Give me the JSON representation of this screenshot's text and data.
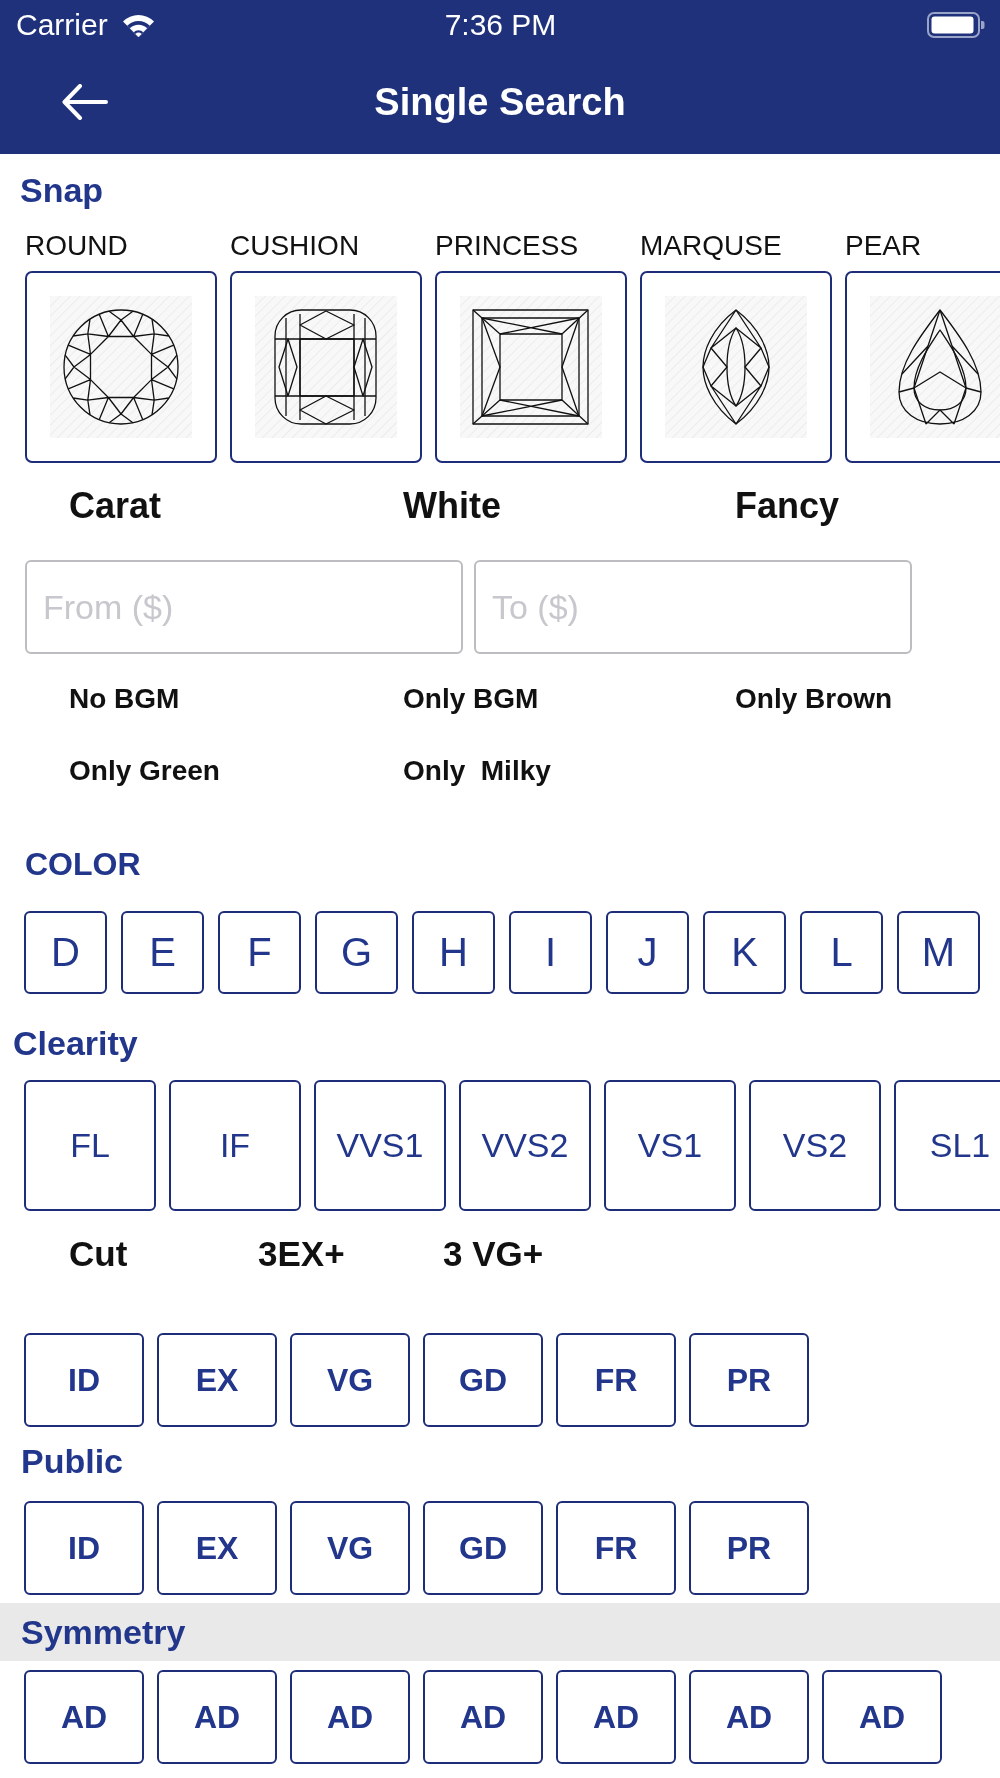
{
  "status_bar": {
    "carrier": "Carrier",
    "time": "7:36 PM"
  },
  "nav_bar": {
    "title": "Single Search"
  },
  "snap": {
    "title": "Snap",
    "shapes": [
      {
        "label": "ROUND",
        "kind": "round"
      },
      {
        "label": "CUSHION",
        "kind": "cushion"
      },
      {
        "label": "PRINCESS",
        "kind": "princess"
      },
      {
        "label": "MARQUSE",
        "kind": "marquise"
      },
      {
        "label": "PEAR",
        "kind": "pear"
      }
    ]
  },
  "price_basis": {
    "options": [
      {
        "label": "Carat"
      },
      {
        "label": "White"
      },
      {
        "label": "Fancy"
      }
    ]
  },
  "price_range": {
    "fields": [
      {
        "placeholder": "From ($)"
      },
      {
        "placeholder": "To ($)"
      }
    ]
  },
  "shade_filters": {
    "options": [
      {
        "label": "No BGM"
      },
      {
        "label": "Only BGM"
      },
      {
        "label": "Only Brown"
      },
      {
        "label": "Only Green"
      },
      {
        "label": "Only  Milky"
      }
    ]
  },
  "color": {
    "title": "COLOR",
    "grades": [
      "D",
      "E",
      "F",
      "G",
      "H",
      "I",
      "J",
      "K",
      "L",
      "M"
    ]
  },
  "clarity": {
    "title": "Clearity",
    "grades": [
      "FL",
      "IF",
      "VVS1",
      "VVS2",
      "VS1",
      "VS2",
      "SL1"
    ]
  },
  "cut": {
    "title": "Cut",
    "presets": [
      "3EX+",
      "3 VG+"
    ],
    "grades": [
      "ID",
      "EX",
      "VG",
      "GD",
      "FR",
      "PR"
    ]
  },
  "public": {
    "title": "Public",
    "grades": [
      "ID",
      "EX",
      "VG",
      "GD",
      "FR",
      "PR"
    ]
  },
  "symmetry": {
    "title": "Symmetry",
    "grades": [
      "AD",
      "AD",
      "AD",
      "AD",
      "AD",
      "AD",
      "AD"
    ]
  }
}
